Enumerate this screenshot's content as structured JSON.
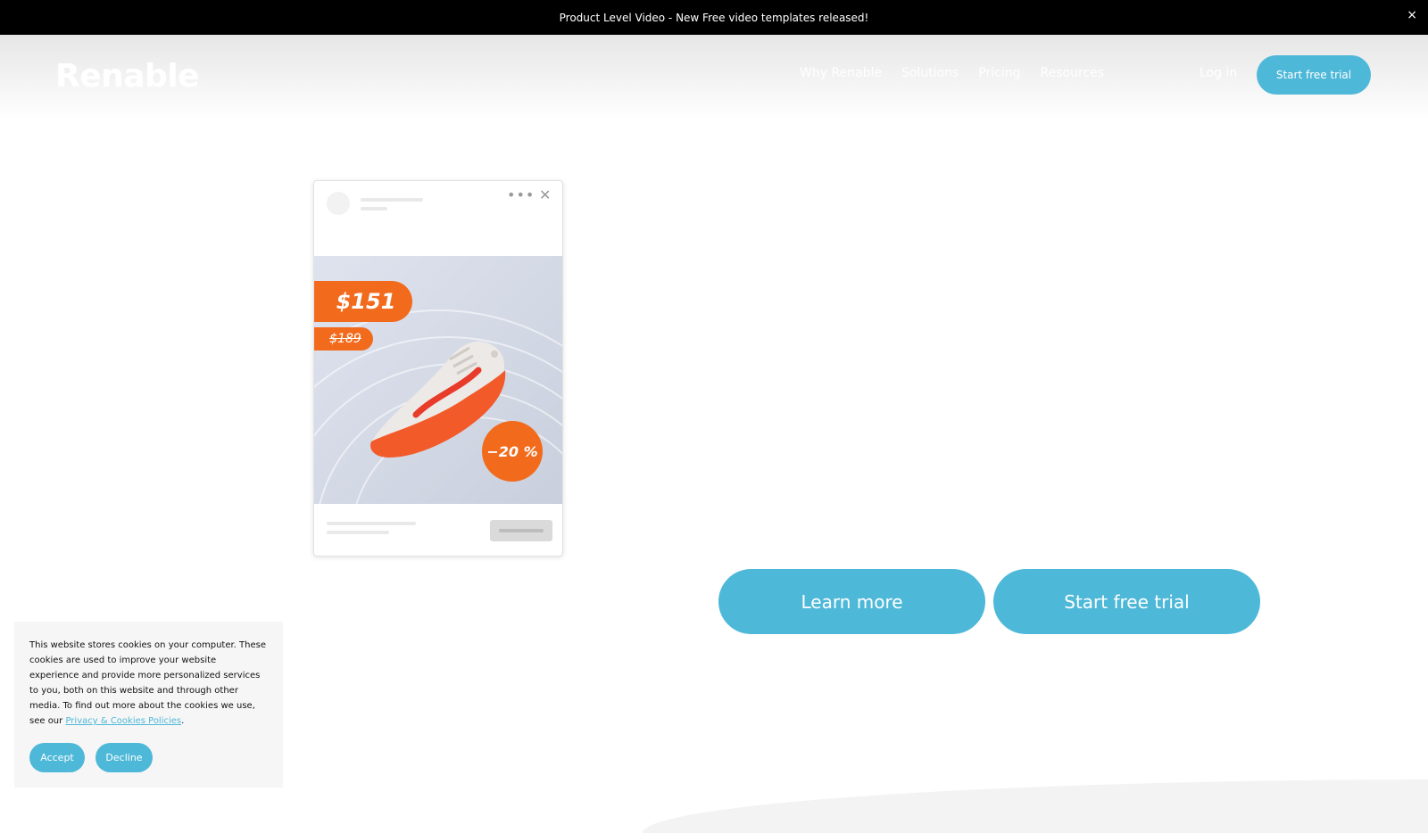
{
  "announcement": {
    "text": "Product Level Video -  New Free video templates released!",
    "close": "×"
  },
  "header": {
    "logo": "Renable",
    "nav": [
      "Why Renable",
      "Solutions",
      "Pricing",
      "Resources"
    ],
    "login": "Log in",
    "cta": "Start free trial"
  },
  "ad_card": {
    "more": "•••",
    "close": "✕",
    "price": "$151",
    "old_price": "$189",
    "discount": "−20 %"
  },
  "hero": {
    "learn_more": "Learn more",
    "start_trial": "Start free trial"
  },
  "cookie": {
    "text": "This website stores cookies on your computer. These cookies are used to improve your website experience and provide more personalized services to you, both on this website and through other media. To find out more about the cookies we use, see our ",
    "link": "Privacy & Cookies Policies",
    "period": ".",
    "accept": "Accept",
    "decline": "Decline"
  },
  "colors": {
    "accent": "#4eb8d8",
    "orange": "#f26b1d"
  }
}
